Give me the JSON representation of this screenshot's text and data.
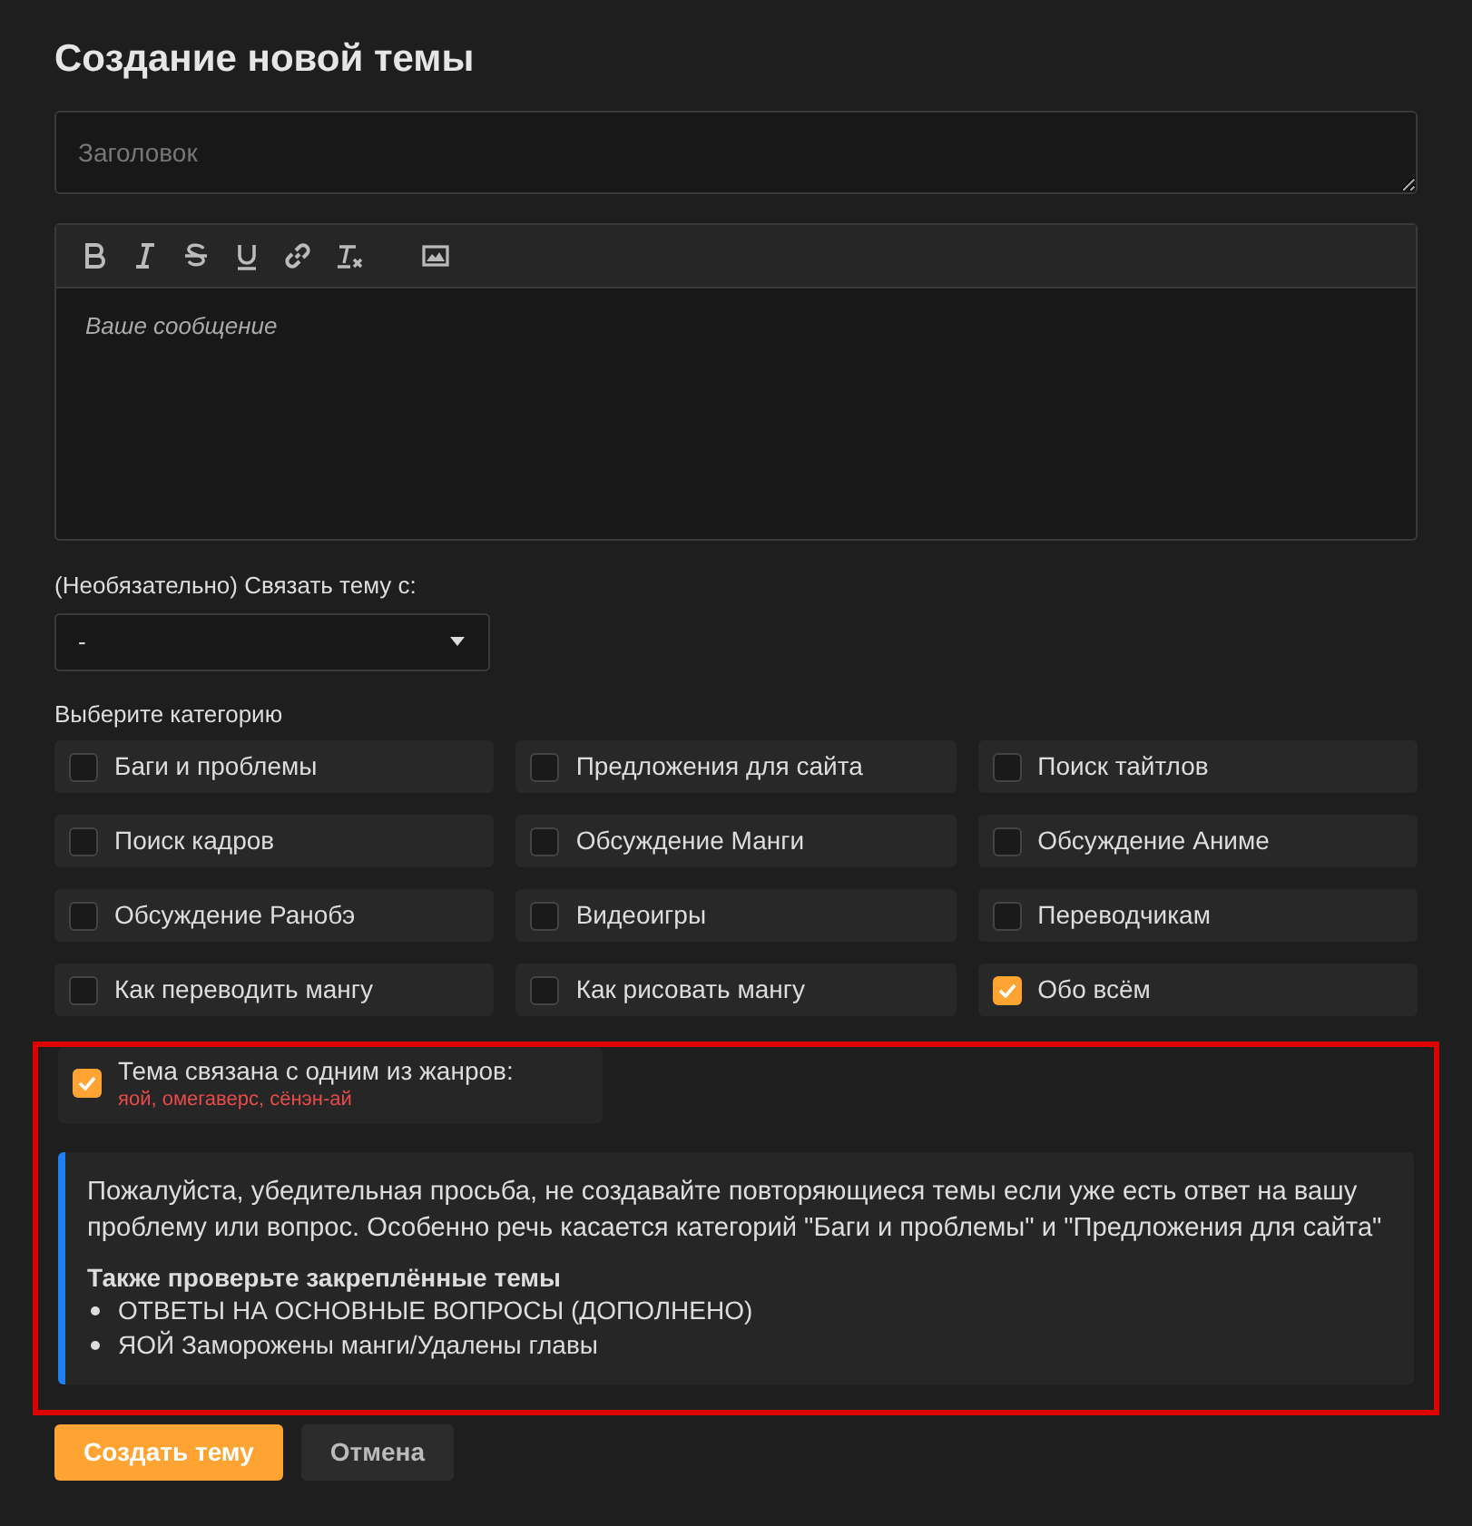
{
  "title": "Создание новой темы",
  "title_field": {
    "placeholder": "Заголовок"
  },
  "editor": {
    "placeholder": "Ваше сообщение",
    "toolbar": [
      {
        "kind": "bold"
      },
      {
        "kind": "italic"
      },
      {
        "kind": "strike"
      },
      {
        "kind": "underline"
      },
      {
        "kind": "link"
      },
      {
        "kind": "clear"
      },
      {
        "kind": "image"
      }
    ]
  },
  "link_topic": {
    "label": "(Необязательно) Связать тему с:",
    "value": "-"
  },
  "categories": {
    "label": "Выберите категорию",
    "items": [
      {
        "label": "Баги и проблемы",
        "checked": false
      },
      {
        "label": "Предложения для сайта",
        "checked": false
      },
      {
        "label": "Поиск тайтлов",
        "checked": false
      },
      {
        "label": "Поиск кадров",
        "checked": false
      },
      {
        "label": "Обсуждение Манги",
        "checked": false
      },
      {
        "label": "Обсуждение Аниме",
        "checked": false
      },
      {
        "label": "Обсуждение Ранобэ",
        "checked": false
      },
      {
        "label": "Видеоигры",
        "checked": false
      },
      {
        "label": "Переводчикам",
        "checked": false
      },
      {
        "label": "Как переводить мангу",
        "checked": false
      },
      {
        "label": "Как рисовать мангу",
        "checked": false
      },
      {
        "label": "Обо всём",
        "checked": true
      }
    ]
  },
  "highlighted": true,
  "genre": {
    "label": "Тема связана с одним из жанров:",
    "genres": "яой, омегаверс, сёнэн-ай",
    "checked": true
  },
  "notice": {
    "text": "Пожалуйста, убедительная просьба, не создавайте повторяющиеся темы если уже есть ответ на вашу проблему или вопрос. Особенно речь касается категорий \"Баги и проблемы\" и \"Предложения для сайта\"",
    "heading": "Также проверьте закреплённые темы",
    "links": [
      "ОТВЕТЫ НА ОСНОВНЫЕ ВОПРОСЫ (ДОПОЛНЕНО)",
      "ЯОЙ Заморожены манги/Удалены главы"
    ]
  },
  "buttons": [
    {
      "label": "Создать тему",
      "kind": "primary"
    },
    {
      "label": "Отмена",
      "kind": "secondary"
    }
  ]
}
